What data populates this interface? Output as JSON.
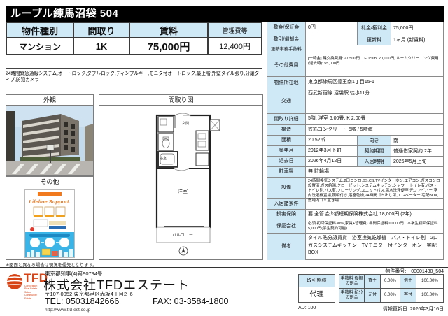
{
  "header": {
    "title": "ルーブル練馬沼袋 504"
  },
  "summary": {
    "col1_header": "物件種別",
    "col2_header": "間取り",
    "col3_header": "賃料",
    "col4_header": "管理費等",
    "col1_value": "マンション",
    "col2_value": "1K",
    "col3_value": "75,000円",
    "col4_value": "12,400円"
  },
  "features_line": "24時間緊急通報システム,オートロック,ダブルロック,ディンプルキー,モニタ付オートロック,最上階,外壁タイル張り,分譲タイプ,防犯カメラ",
  "panels": {
    "exterior_label": "外観",
    "floorplan_label": "間取り図",
    "other_label": "その他",
    "flyer_title": "Lifeline Support.",
    "note": "※図面と異なる場合は現況を優先となります。"
  },
  "floorplan": {
    "room_label": "洋室",
    "balcony_label": "バルコニー",
    "bath_label": "浴室",
    "entrance_label": "玄関"
  },
  "details": {
    "shikikin_label": "敷金/保証金",
    "shikikin": "0円",
    "reikin_label": "礼金/権利金",
    "reikin": "75,000円",
    "shikibiki_label": "敷引/償却金",
    "shikibiki": "",
    "koshinryo_label": "更新料",
    "koshinryo": "1ヶ月 (新賃料)",
    "koshin_jimu_label": "更新事務手数料",
    "koshin_jimu": "",
    "sonota_label": "その他費用",
    "sonota": "[一時金] 鍵交換費用: 27,500円, TFDclub: 20,000円, ルームクリーニング費用(退去時): 55,000円",
    "shozaichi_label": "物件所在地",
    "shozaichi": "東京都練馬区豊玉南1丁目15-1",
    "kotsu_label": "交通",
    "kotsu": "西武新宿線 沼袋駅 徒歩11分",
    "madori_label": "間取り詳細",
    "madori": "5階: 洋室 6.00畳, K 2.00畳",
    "kozo_label": "構造",
    "kozo": "鉄筋コンクリート 5階 / 5階建",
    "menseki_label": "面積",
    "menseki": "20.52㎡",
    "muki_label": "向き",
    "muki": "南",
    "chikunen_label": "築年月",
    "chikunen": "2012年3月下旬",
    "keiyaku_label": "契約期間",
    "keiyaku": "普通借家契約 2年",
    "taikyo_label": "退去日",
    "taikyo": "2026年4月12日",
    "nyukyo_label": "入居時期",
    "nyukyo": "2026年5月上旬",
    "chusha_label": "駐車場",
    "chusha": "無 駐輪場",
    "setsubi_label": "設備",
    "setsubi": "24時間換気システム,2口コンロ,BS,CS,TVインターホン,エアコン,ガスコンロ設置済,ガス給湯,クローゼット,システムキッチン,シャワー,トイレ有,バス・トイレ別,バス有,フローリング,ユニットバス,温水洗浄便座,光ファイバー,室内洗濯機置場,照明付き,浴室乾燥,24時間ゴミ出し可,エレベーター,宅配BOX,敷地内ゴミ置き場",
    "joken_label": "入居諸条件",
    "joken": "",
    "hoken_label": "損害保険",
    "hoken": "要 全管協少額短期保険株式会社 18,000円 (2年)",
    "hosho_label": "保証会社",
    "hosho": "必須 初回保証料30%(家賃+管理費) 年間保証料10,000円　※学生初回保証料5,000円(学生契約可能)",
    "biko_label": "備考",
    "biko": "タイル貼分譲賃貸　浴室換気乾燥機　バス・トイレ別　2口ガスシステムキッチン　TVモニター付インターホン　宅配BOX"
  },
  "footer": {
    "license": "東京都知事(4)第90794号",
    "company": "株式会社TFDエステート",
    "address": "〒107-0052 東京都港区赤坂4丁目2−6",
    "tel": "TEL: 05031842666",
    "fax": "FAX: 03-3584-1800",
    "url": "http://www.tfd-est.co.jp",
    "logo_text": "TFD",
    "logo_sub": "Corporation\nReal Estate Sales\nCommunity\nEstate",
    "prop_no": "物件番号:　00001430_504",
    "deal_type_label": "取引態様",
    "deal_type": "代理",
    "fee_burden_label": "手数料 負担の割合",
    "fee_split_label": "手数料 配分の割合",
    "kashinushi_label": "貸主",
    "kashinushi_pct": "0.00%",
    "karinushi_label": "借主",
    "karinushi_pct": "100.00%",
    "motozuke_label": "元付",
    "motozuke_pct": "0.00%",
    "kyakuzuke_label": "客付",
    "kyakuzuke_pct": "100.00%",
    "ad": "AD: 100",
    "updated": "情報更新日: 2026年3月16日"
  },
  "colors": {
    "accent_blue": "#cfe9f7",
    "brand_red": "#d84315",
    "flyer_blue": "#3ab3e6"
  }
}
